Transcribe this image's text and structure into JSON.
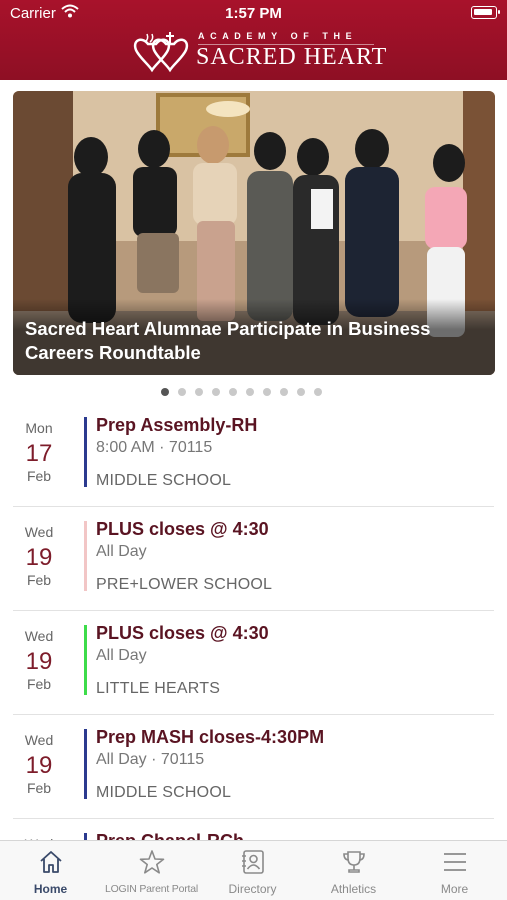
{
  "status": {
    "carrier": "Carrier",
    "time": "1:57 PM"
  },
  "header": {
    "logo_top": "ACADEMY OF THE",
    "logo_bottom": "SACRED HEART"
  },
  "hero": {
    "title": "Sacred Heart Alumnae Participate in Business Careers Roundtable",
    "slide_count": 10,
    "active_slide": 1
  },
  "events": [
    {
      "dow": "Mon",
      "day": "17",
      "month": "Feb",
      "title": "Prep Assembly-RH",
      "time": "8:00 AM · 70115",
      "group": "MIDDLE SCHOOL",
      "color": "#2b3a8f"
    },
    {
      "dow": "Wed",
      "day": "19",
      "month": "Feb",
      "title": "PLUS closes @ 4:30",
      "time": "All Day",
      "group": "PRE+LOWER SCHOOL",
      "color": "#f2c6c6"
    },
    {
      "dow": "Wed",
      "day": "19",
      "month": "Feb",
      "title": "PLUS closes @ 4:30",
      "time": "All Day",
      "group": "LITTLE HEARTS",
      "color": "#3ddc4a"
    },
    {
      "dow": "Wed",
      "day": "19",
      "month": "Feb",
      "title": "Prep MASH closes-4:30PM",
      "time": "All Day · 70115",
      "group": "MIDDLE SCHOOL",
      "color": "#2b3a8f"
    },
    {
      "dow": "Wed",
      "day": "",
      "month": "",
      "title": "Prep Chapel-RCh",
      "time": "",
      "group": "",
      "color": "#2b3a8f"
    }
  ],
  "tabs": [
    {
      "label": "Home",
      "icon": "home-icon"
    },
    {
      "label": "LOGIN Parent Portal",
      "icon": "star-icon"
    },
    {
      "label": "Directory",
      "icon": "contact-card-icon"
    },
    {
      "label": "Athletics",
      "icon": "trophy-icon"
    },
    {
      "label": "More",
      "icon": "menu-icon"
    }
  ],
  "colors": {
    "brand": "#a8122b",
    "title_text": "#5a1422",
    "date_text": "#7d1c2a",
    "tab_active": "#3a4a6a"
  }
}
